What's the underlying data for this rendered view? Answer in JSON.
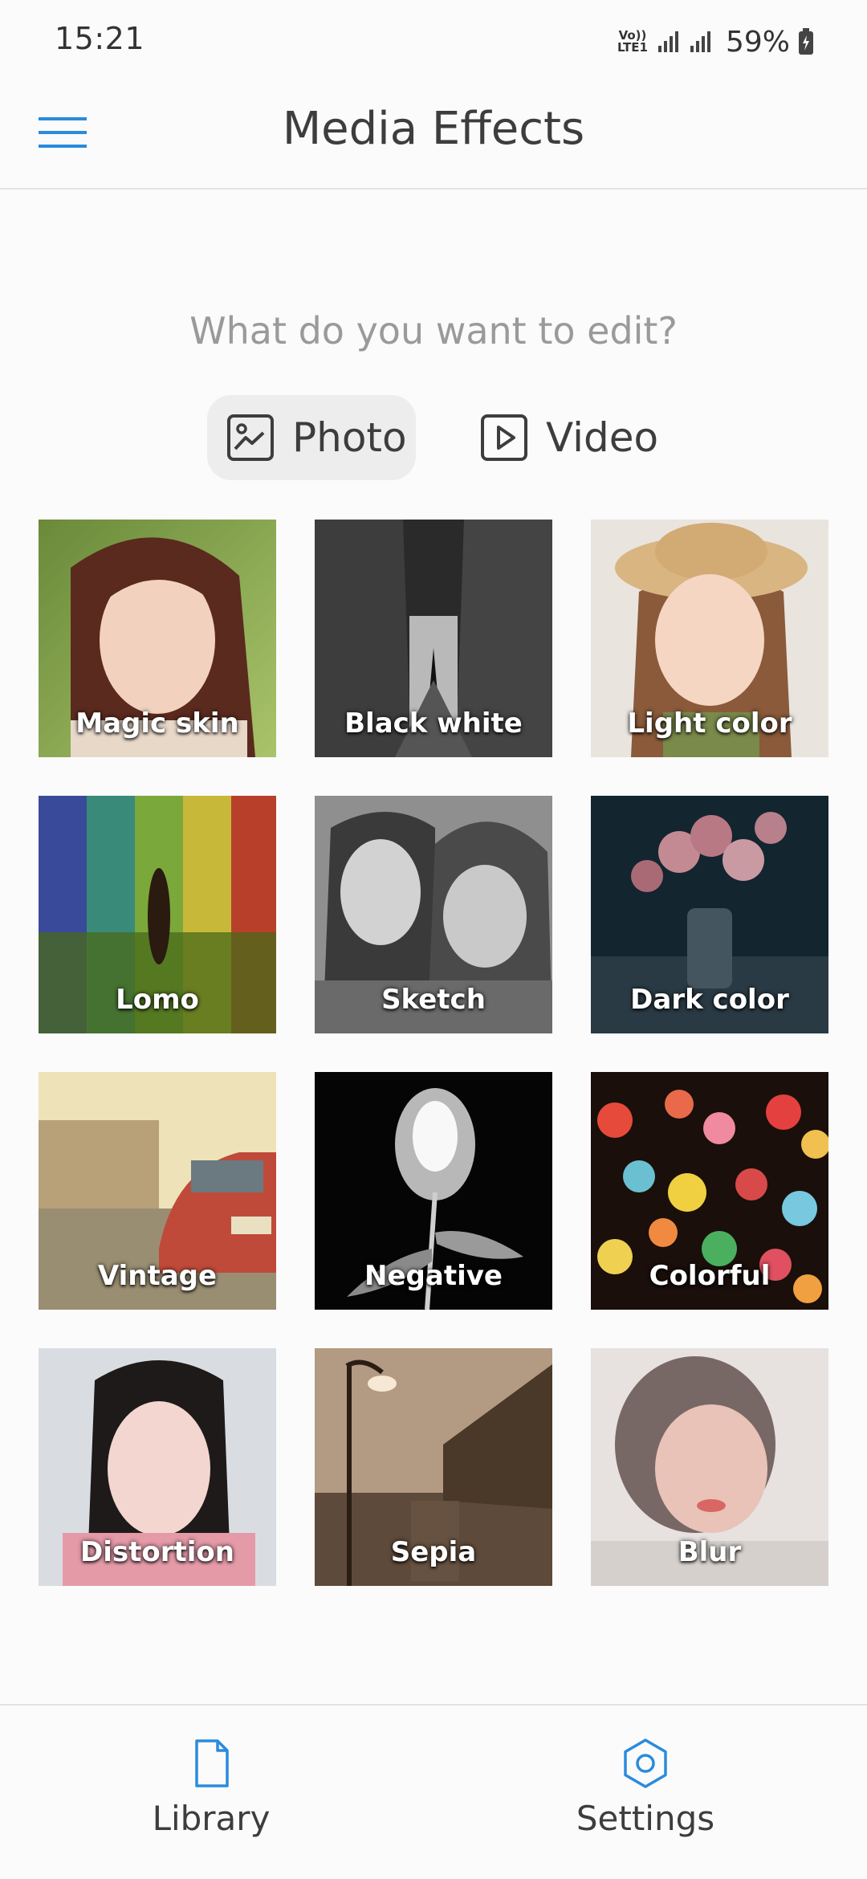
{
  "status_bar": {
    "time": "15:21",
    "network_badge_top": "Vo))",
    "network_badge_bottom": "LTE1",
    "battery": "59%"
  },
  "app_bar": {
    "title": "Media Effects",
    "menu_icon": "hamburger-menu-icon"
  },
  "prompt": "What do you want to edit?",
  "tabs": [
    {
      "label": "Photo",
      "icon": "image-icon",
      "selected": true
    },
    {
      "label": "Video",
      "icon": "play-icon",
      "selected": false
    }
  ],
  "effects": [
    {
      "label": "Magic skin"
    },
    {
      "label": "Black white"
    },
    {
      "label": "Light color"
    },
    {
      "label": "Lomo"
    },
    {
      "label": "Sketch"
    },
    {
      "label": "Dark color"
    },
    {
      "label": "Vintage"
    },
    {
      "label": "Negative"
    },
    {
      "label": "Colorful"
    },
    {
      "label": "Distortion"
    },
    {
      "label": "Sepia"
    },
    {
      "label": "Blur"
    }
  ],
  "bottom_nav": [
    {
      "label": "Library",
      "icon": "document-icon"
    },
    {
      "label": "Settings",
      "icon": "settings-icon"
    }
  ],
  "colors": {
    "accent": "#2a8bdc",
    "text": "#3d3d3d",
    "muted_text": "#9a9a9a"
  }
}
